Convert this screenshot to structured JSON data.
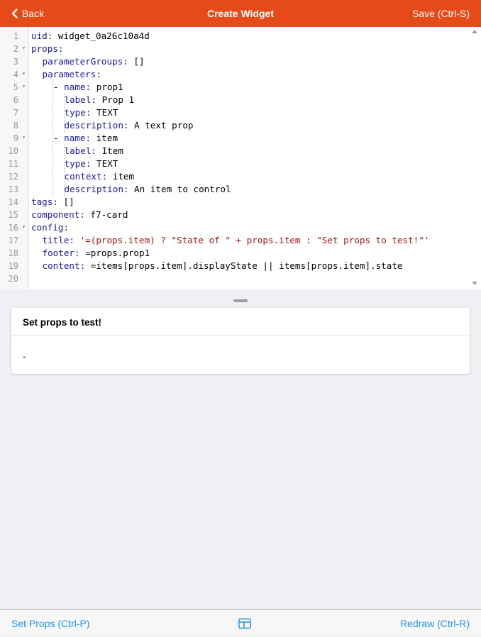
{
  "header": {
    "back_label": "Back",
    "title": "Create Widget",
    "save_label": "Save (Ctrl-S)"
  },
  "editor": {
    "lines": [
      {
        "n": "1",
        "indent": 0,
        "key": "uid",
        "value": " widget_0a26c10a4d",
        "fold": false
      },
      {
        "n": "2",
        "indent": 0,
        "key": "props",
        "value": "",
        "fold": true
      },
      {
        "n": "3",
        "indent": 1,
        "key": "parameterGroups",
        "value": " []",
        "fold": false
      },
      {
        "n": "4",
        "indent": 1,
        "key": "parameters",
        "value": "",
        "fold": true
      },
      {
        "n": "5",
        "indent": 2,
        "dash": true,
        "key": "name",
        "value": " prop1",
        "fold": true
      },
      {
        "n": "6",
        "indent": 3,
        "key": "label",
        "value": " Prop 1",
        "fold": false
      },
      {
        "n": "7",
        "indent": 3,
        "key": "type",
        "value": " TEXT",
        "fold": false
      },
      {
        "n": "8",
        "indent": 3,
        "key": "description",
        "value": " A text prop",
        "fold": false
      },
      {
        "n": "9",
        "indent": 2,
        "dash": true,
        "key": "name",
        "value": " item",
        "fold": true
      },
      {
        "n": "10",
        "indent": 3,
        "key": "label",
        "value": " Item",
        "fold": false
      },
      {
        "n": "11",
        "indent": 3,
        "key": "type",
        "value": " TEXT",
        "fold": false
      },
      {
        "n": "12",
        "indent": 3,
        "key": "context",
        "value": " item",
        "fold": false
      },
      {
        "n": "13",
        "indent": 3,
        "key": "description",
        "value": " An item to control",
        "fold": false
      },
      {
        "n": "14",
        "indent": 0,
        "key": "tags",
        "value": " []",
        "fold": false
      },
      {
        "n": "15",
        "indent": 0,
        "key": "component",
        "value": " f7-card",
        "fold": false
      },
      {
        "n": "16",
        "indent": 0,
        "key": "config",
        "value": "",
        "fold": true
      },
      {
        "n": "17",
        "indent": 1,
        "key": "title",
        "value": " '=(props.item) ? \"State of \" + props.item : \"Set props to test!\"'",
        "string": true,
        "fold": false
      },
      {
        "n": "18",
        "indent": 1,
        "key": "footer",
        "value": " =props.prop1",
        "fold": false
      },
      {
        "n": "19",
        "indent": 1,
        "key": "content",
        "value": " =items[props.item].displayState || items[props.item].state",
        "fold": false
      },
      {
        "n": "20",
        "indent": 0,
        "key": "",
        "value": "",
        "fold": false
      }
    ]
  },
  "preview": {
    "card_title": "Set props to test!",
    "card_content": "-"
  },
  "footer": {
    "set_props_label": "Set Props (Ctrl-P)",
    "layout_icon": "layout-split-icon",
    "redraw_label": "Redraw (Ctrl-R)"
  },
  "colors": {
    "navbar": "#e64a19",
    "link": "#2196f3",
    "yaml_key": "#1a1aa6",
    "yaml_string": "#a31515"
  }
}
